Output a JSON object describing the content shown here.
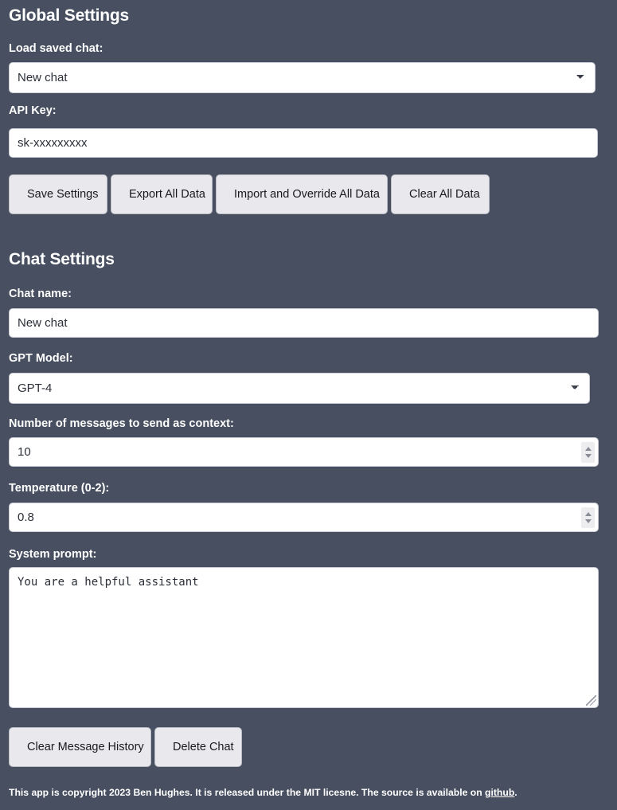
{
  "theme": {
    "background": "#474f60",
    "control_bg": "#ffffff",
    "control_text": "#2b2f38",
    "button_bg": "#e9e9ed",
    "button_text": "#19191d",
    "label_text": "#ffffff"
  },
  "global_settings": {
    "title": "Global Settings",
    "load_saved_chat": {
      "label": "Load saved chat:",
      "selected": "New chat",
      "options": [
        "New chat"
      ],
      "icon": "chevron-down-icon"
    },
    "api_key": {
      "label": "API Key:",
      "value": "sk-xxxxxxxxx",
      "placeholder": ""
    },
    "buttons": {
      "save_settings": "Save Settings",
      "export_all_data": "Export All Data",
      "import_and_override_all_data": "Import and Override All Data",
      "clear_all_data": "Clear All Data"
    }
  },
  "chat_settings": {
    "title": "Chat Settings",
    "chat_name": {
      "label": "Chat name:",
      "value": "New chat",
      "placeholder": ""
    },
    "gpt_model": {
      "label": "GPT Model:",
      "selected": "GPT-4",
      "options": [
        "GPT-4"
      ],
      "icon": "chevron-down-icon"
    },
    "context_messages": {
      "label": "Number of messages to send as context:",
      "value": "10",
      "spinner_up_icon": "chevron-up-icon",
      "spinner_down_icon": "chevron-down-icon"
    },
    "temperature": {
      "label": "Temperature (0-2):",
      "value": "0.8",
      "spinner_up_icon": "chevron-up-icon",
      "spinner_down_icon": "chevron-down-icon"
    },
    "system_prompt": {
      "label": "System prompt:",
      "value": "You are a helpful assistant",
      "placeholder": "",
      "resize_handle_icon": "resize-grip-icon"
    },
    "buttons": {
      "clear_message_history": "Clear Message History",
      "delete_chat": "Delete Chat"
    }
  },
  "footer": {
    "text_before_link": "This app is copyright 2023 Ben Hughes. It is released under the MIT licesne. The source is available on ",
    "link_label": "github",
    "text_after_link": "."
  }
}
